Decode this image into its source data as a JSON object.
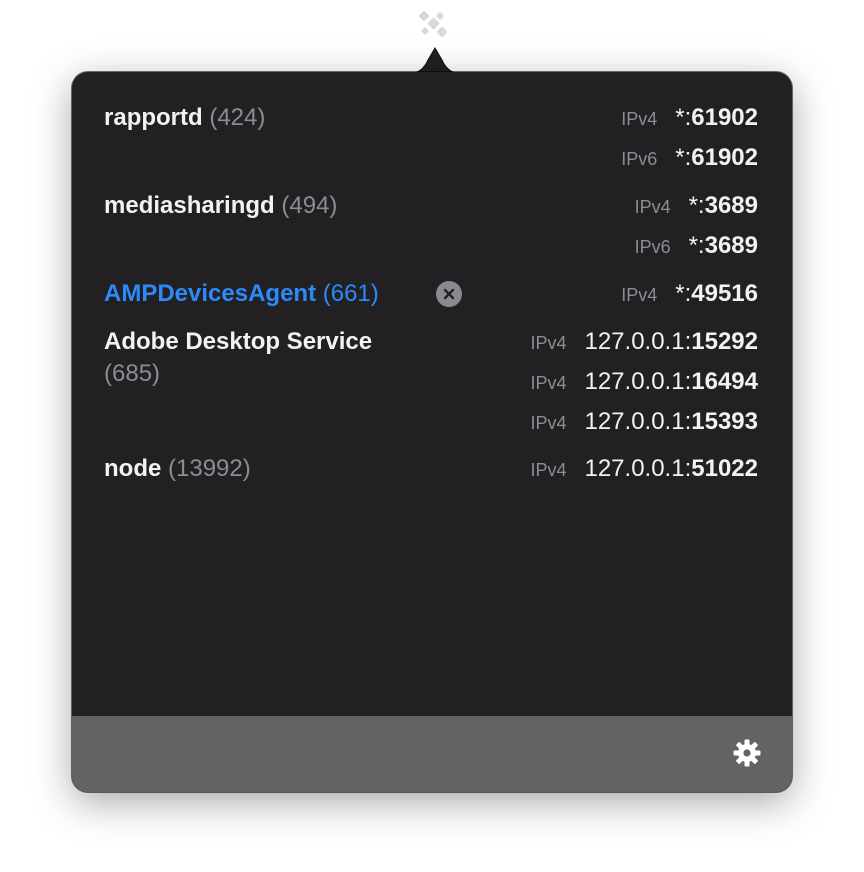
{
  "menubar": {
    "icon": "network-ports-icon"
  },
  "processes": [
    {
      "name": "rapportd",
      "pid": "(424)",
      "active": false,
      "addresses": [
        {
          "proto": "IPv4",
          "host": "*:",
          "port": "61902"
        },
        {
          "proto": "IPv6",
          "host": "*:",
          "port": "61902"
        }
      ]
    },
    {
      "name": "mediasharingd",
      "pid": "(494)",
      "active": false,
      "addresses": [
        {
          "proto": "IPv4",
          "host": "*:",
          "port": "3689"
        },
        {
          "proto": "IPv6",
          "host": "*:",
          "port": "3689"
        }
      ]
    },
    {
      "name": "AMPDevicesAgent",
      "pid": "(661)",
      "active": true,
      "addresses": [
        {
          "proto": "IPv4",
          "host": "*:",
          "port": "49516"
        }
      ]
    },
    {
      "name": "Adobe Desktop Service",
      "pid": "(685)",
      "active": false,
      "addresses": [
        {
          "proto": "IPv4",
          "host": "127.0.0.1:",
          "port": "15292"
        },
        {
          "proto": "IPv4",
          "host": "127.0.0.1:",
          "port": "16494"
        },
        {
          "proto": "IPv4",
          "host": "127.0.0.1:",
          "port": "15393"
        }
      ]
    },
    {
      "name": "node",
      "pid": "(13992)",
      "active": false,
      "addresses": [
        {
          "proto": "IPv4",
          "host": "127.0.0.1:",
          "port": "51022"
        }
      ]
    }
  ],
  "footer": {
    "settings_icon": "gear-icon"
  },
  "colors": {
    "background": "#222023",
    "footer": "#636264",
    "text": "#f2f2f2",
    "muted": "#8d8d91",
    "accent": "#2b8af7"
  }
}
